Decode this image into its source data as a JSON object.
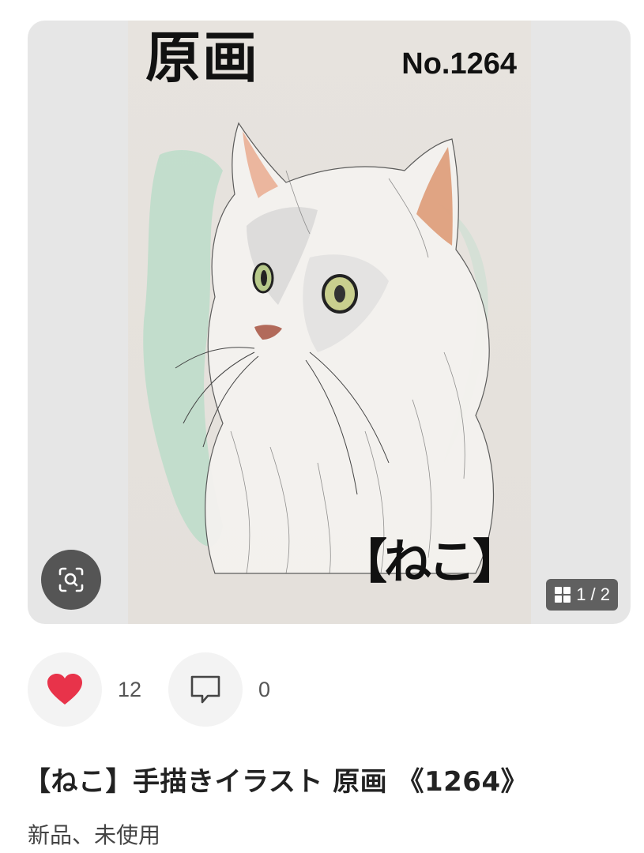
{
  "artwork": {
    "title_text": "原画",
    "number_text": "No.1264",
    "label_text": "【ねこ】",
    "image_alt": "Watercolor illustration of a white long-haired cat"
  },
  "gallery": {
    "zoom_icon": "zoom-scan-icon",
    "page_indicator": "1 / 2",
    "grid_icon": "grid-icon"
  },
  "actions": {
    "like_icon": "heart-icon",
    "like_color": "#e8334a",
    "like_count": "12",
    "comment_icon": "comment-icon",
    "comment_count": "0"
  },
  "product": {
    "title": "【ねこ】手描きイラスト 原画 《1264》",
    "condition": "新品、未使用"
  }
}
